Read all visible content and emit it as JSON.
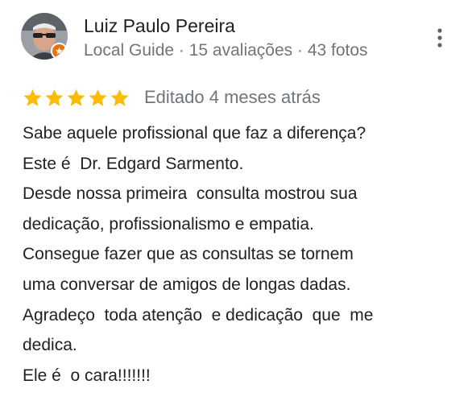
{
  "author": {
    "name": "Luiz Paulo Pereira",
    "meta": "Local Guide · 15 avaliações · 43 fotos",
    "avatar_icon": "user-avatar-photo",
    "badge_icon": "local-guide-star-badge",
    "badge_color": "#e8710a"
  },
  "menu": {
    "icon": "more-vertical-icon"
  },
  "rating": {
    "stars": 5,
    "max_stars": 5,
    "star_color": "#fbbc04",
    "edited": "Editado 4 meses atrás"
  },
  "review_lines": [
    "Sabe aquele profissional que faz a diferença?",
    "Este é  Dr. Edgard Sarmento.",
    "Desde nossa primeira  consulta mostrou sua",
    "dedicação, profissionalismo e empatia.",
    "Consegue fazer que as consultas se tornem",
    "uma conversar de amigos de longas dadas.",
    "Agradeço  toda atenção  e dedicação  que  me",
    "dedica.",
    "Ele é  o cara!!!!!!!"
  ]
}
